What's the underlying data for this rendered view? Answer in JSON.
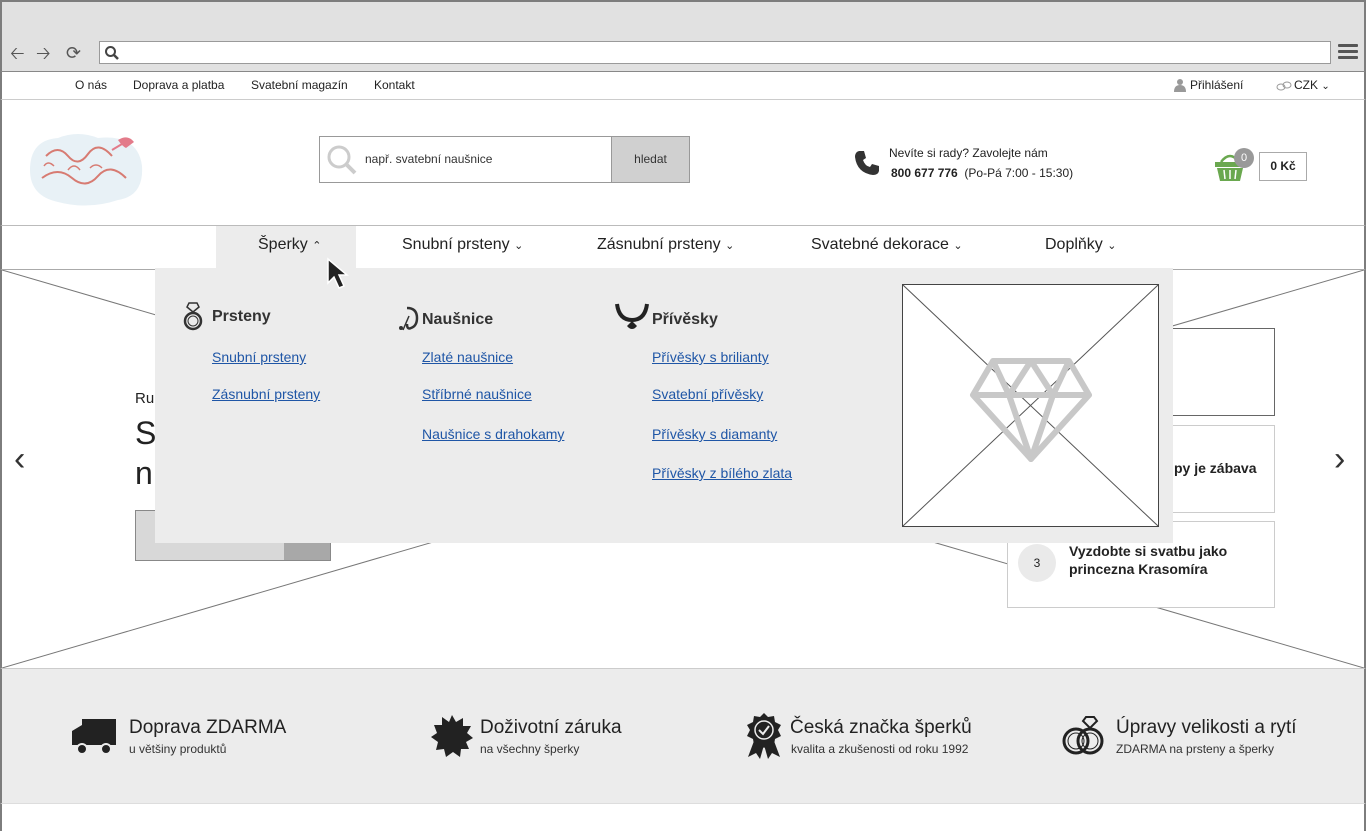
{
  "top_links": [
    "O nás",
    "Doprava a platba",
    "Svatební magazín",
    "Kontakt"
  ],
  "account": {
    "login": "Přihlášení",
    "currency": "CZK"
  },
  "search": {
    "placeholder": "např. svatební naušnice",
    "button": "hledat"
  },
  "help": {
    "text": "Nevíte si rady? Zavolejte nám",
    "phone": "800 677 776",
    "hours": "(Po-Pá 7:00 - 15:30)"
  },
  "cart": {
    "count": "0",
    "price": "0 Kč"
  },
  "nav": [
    "Šperky",
    "Snubní prsteny",
    "Zásnubní prsteny",
    "Svatebné dekorace",
    "Doplňky"
  ],
  "dropdown": {
    "columns": [
      {
        "title": "Prsteny",
        "icon": "ring-icon",
        "links": [
          "Snubní prsteny",
          "Zásnubní prsteny"
        ]
      },
      {
        "title": "Naušnice",
        "icon": "earring-icon",
        "links": [
          "Zlaté naušnice",
          "Stříbrné naušnice",
          "Naušnice s drahokamy"
        ]
      },
      {
        "title": "Přívěsky",
        "icon": "necklace-icon",
        "links": [
          "Přívěsky s brilianty",
          "Svatební přívěsky",
          "Přívěsky s diamanty",
          "Přívěsky z bílého zlata"
        ]
      }
    ]
  },
  "hero": {
    "fragments": [
      "Ru",
      "S",
      "n"
    ],
    "slides": [
      {
        "number": "",
        "text": "py je zábava"
      },
      {
        "number": "3",
        "text": "Vyzdobte si svatbu jako princezna Krasomíra"
      }
    ]
  },
  "benefits": [
    {
      "title": "Doprava ZDARMA",
      "sub": "u většiny produktů",
      "icon": "truck-icon"
    },
    {
      "title": "Doživotní záruka",
      "sub": "na všechny šperky",
      "icon": "badge-icon"
    },
    {
      "title": "Česká značka šperků",
      "sub": "kvalita a zkušenosti od roku 1992",
      "icon": "award-icon"
    },
    {
      "title": "Úpravy velikosti a rytí",
      "sub": "ZDARMA na prsteny a šperky",
      "icon": "rings-icon"
    }
  ]
}
